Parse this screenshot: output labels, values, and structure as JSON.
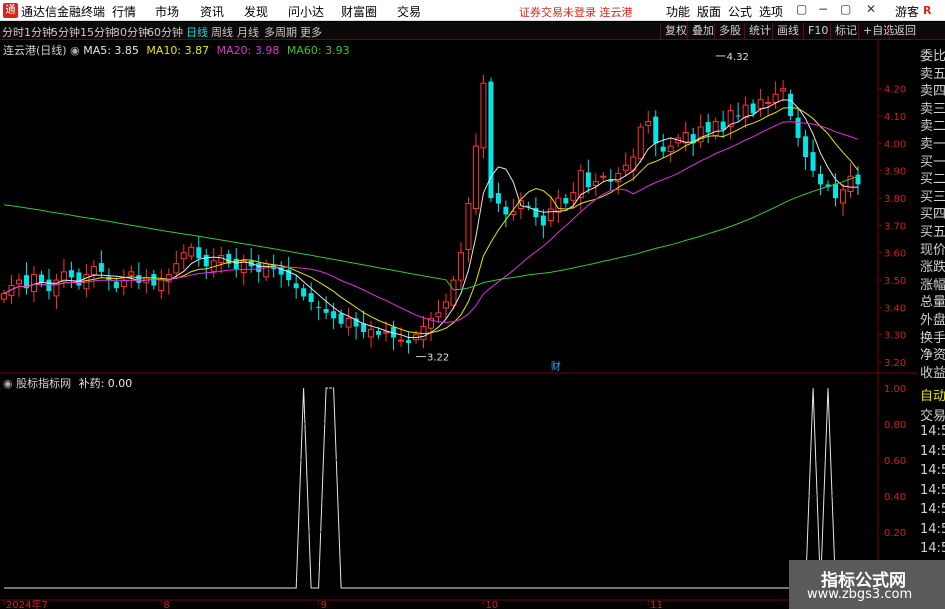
{
  "app": {
    "title": "通达信金融终端",
    "account_status": "证券交易未登录",
    "stock_name_header": "连云港",
    "guest": "游客",
    "r_logo": "R"
  },
  "menu": [
    "行情",
    "市场",
    "资讯",
    "发现",
    "问小达",
    "财富圈",
    "交易"
  ],
  "right_menu": [
    "功能",
    "版面",
    "公式",
    "选项"
  ],
  "window_buttons": [
    "▢",
    "−",
    "▢",
    "✕"
  ],
  "periods": [
    "分时",
    "1分钟",
    "5分钟",
    "15分钟",
    "30分钟",
    "60分钟",
    "日线",
    "周线",
    "月线",
    "多周期",
    "更多"
  ],
  "active_period": "日线",
  "tool_buttons": [
    "复权",
    "叠加",
    "多股",
    "统计",
    "画线",
    "F10",
    "标记",
    "+自选",
    "返回"
  ],
  "main_info": {
    "name": "连云港(日线)",
    "ma5": "MA5: 3.85",
    "ma10": "MA10: 3.87",
    "ma20": "MA20: 3.98",
    "ma60": "MA60: 3.93"
  },
  "sub_info": {
    "name": "股标指标网",
    "value": "补药: 0.00"
  },
  "annotations": {
    "high": "4.32",
    "low": "3.22",
    "fin_mark": "财"
  },
  "price_axis": [
    "4.20",
    "4.10",
    "4.00",
    "3.90",
    "3.80",
    "3.70",
    "3.60",
    "3.50",
    "3.40",
    "3.30",
    "3.20"
  ],
  "sub_axis": [
    "1.00",
    "0.80",
    "0.60",
    "0.40",
    "0.20"
  ],
  "date_axis": [
    "2024年7",
    "8",
    "9",
    "10",
    "11",
    "12"
  ],
  "side_top": [
    "委比",
    "卖五",
    "卖四",
    "卖三",
    "卖二",
    "卖一",
    "买一",
    "买二",
    "买三",
    "买四",
    "买五",
    "现价",
    "涨跌",
    "涨幅",
    "总量",
    "外盘",
    "换手",
    "净资",
    "收益"
  ],
  "side_bottom": [
    "自动",
    "交易",
    "14:56",
    "14:56",
    "14:56",
    "14:56",
    "14:56",
    "14:56",
    "14:56",
    "14:56"
  ],
  "watermark": {
    "line1": "指标公式网",
    "line2": "www.zbgs3.com"
  },
  "colors": {
    "up": "#ff3232",
    "down": "#00e6e6",
    "ma5": "#e6e6e6",
    "ma10": "#e6e600",
    "ma20": "#dc32dc",
    "ma60": "#32c832",
    "grid": "#7a0000"
  },
  "chart_data": {
    "type": "candlestick",
    "closes": [
      3.45,
      3.48,
      3.5,
      3.47,
      3.52,
      3.49,
      3.46,
      3.5,
      3.53,
      3.51,
      3.48,
      3.52,
      3.55,
      3.53,
      3.5,
      3.47,
      3.5,
      3.53,
      3.49,
      3.51,
      3.48,
      3.5,
      3.52,
      3.56,
      3.6,
      3.62,
      3.58,
      3.55,
      3.57,
      3.59,
      3.56,
      3.54,
      3.57,
      3.55,
      3.53,
      3.56,
      3.54,
      3.52,
      3.5,
      3.47,
      3.44,
      3.42,
      3.4,
      3.38,
      3.36,
      3.34,
      3.36,
      3.33,
      3.31,
      3.32,
      3.3,
      3.31,
      3.29,
      3.28,
      3.27,
      3.3,
      3.33,
      3.36,
      3.38,
      3.42,
      3.5,
      3.6,
      3.78,
      3.99,
      4.22,
      3.8,
      3.78,
      3.74,
      3.75,
      3.79,
      3.77,
      3.73,
      3.7,
      3.76,
      3.8,
      3.78,
      3.82,
      3.9,
      3.84,
      3.86,
      3.88,
      3.86,
      3.89,
      3.92,
      3.95,
      4.06,
      4.08,
      4.0,
      3.97,
      3.99,
      4.02,
      4.04,
      4.0,
      4.06,
      4.04,
      4.08,
      4.05,
      4.12,
      4.1,
      4.14,
      4.11,
      4.16,
      4.15,
      4.18,
      4.2,
      4.1,
      4.02,
      3.95,
      3.9,
      3.85,
      3.84,
      3.8,
      3.83,
      3.88,
      3.85
    ],
    "ma5_last": 3.85,
    "ma10_last": 3.87,
    "ma20_last": 3.98,
    "ma60_last": 3.93,
    "high_mark": 4.32,
    "low_mark": 3.22,
    "price_range": [
      3.16,
      4.36
    ],
    "indicator": {
      "name": "补药",
      "value": 0.0,
      "spikes_at": [
        40,
        43,
        44,
        108,
        110
      ],
      "range": [
        0,
        1
      ]
    },
    "x_axis_start": "2024年7"
  }
}
